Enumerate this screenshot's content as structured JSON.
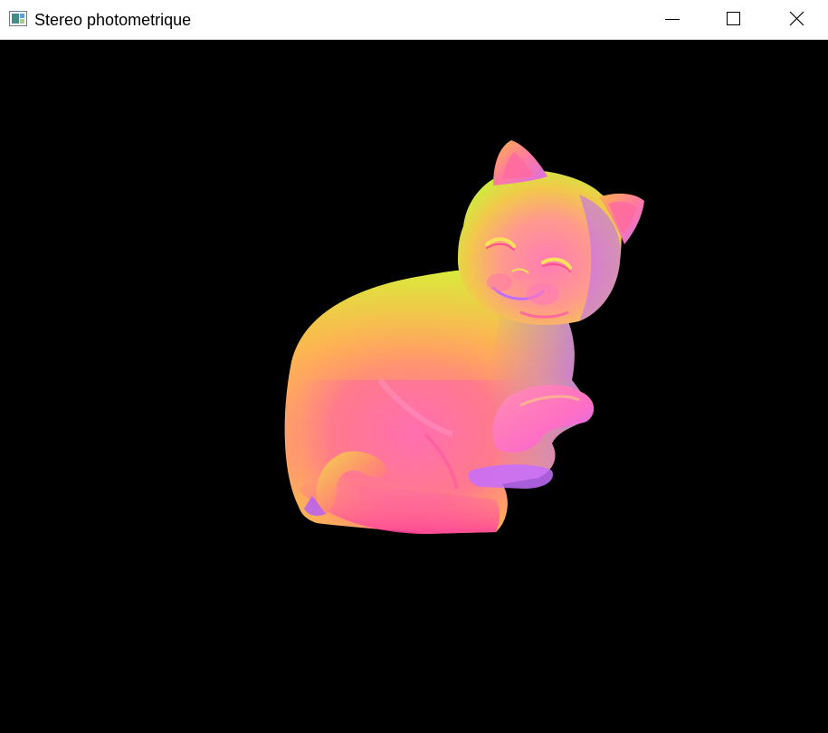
{
  "window": {
    "title": "Stereo photometrique",
    "controls": {
      "minimize_icon": "minimize-icon",
      "maximize_icon": "maximize-icon",
      "close_icon": "close-icon"
    }
  },
  "canvas": {
    "background": "#000000",
    "content": "normal-map-cat"
  },
  "colors": {
    "titlebar_bg": "#ffffff",
    "normal_red": "#ff4fa0",
    "normal_green": "#c8f53a",
    "normal_blue": "#b06cff",
    "normal_orange": "#ff9a4a"
  }
}
